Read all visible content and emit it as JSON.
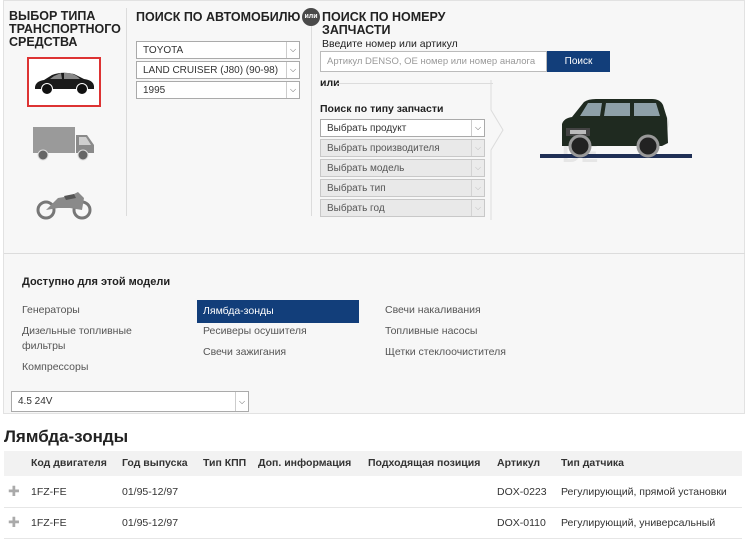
{
  "vehicle_type": {
    "title_lines": [
      "ВЫБОР ТИПА",
      "ТРАНСПОРТНОГО",
      "СРЕДСТВА"
    ],
    "types": [
      {
        "name": "car",
        "selected": true
      },
      {
        "name": "truck",
        "selected": false
      },
      {
        "name": "motorcycle",
        "selected": false
      }
    ]
  },
  "by_auto": {
    "title": "ПОИСК ПО АВТОМОБИЛЮ",
    "make": "TOYOTA",
    "model": "LAND CRUISER (J80) (90-98)",
    "year": "1995"
  },
  "or_badge": "или",
  "by_number": {
    "title_lines": [
      "ПОИСК ПО НОМЕРУ",
      "ЗАПЧАСТИ"
    ],
    "prompt": "Введите номер или артикул",
    "placeholder": "Артикул DENSO, OE номер или номер аналога",
    "button": "Поиск",
    "or_label": "или"
  },
  "by_part_type": {
    "title": "Поиск по типу запчасти",
    "selects": [
      "Выбрать продукт",
      "Выбрать производителя",
      "Выбрать модель",
      "Выбрать тип",
      "Выбрать год"
    ]
  },
  "available": {
    "title": "Доступно для этой модели",
    "col1": [
      "Генераторы",
      "Дизельные топливные",
      "фильтры",
      "Компрессоры"
    ],
    "col2": [
      "Лямбда-зонды",
      "Ресиверы осушителя",
      "Свечи зажигания"
    ],
    "col3": [
      "Свечи накаливания",
      "Топливные насосы",
      "Щетки стеклоочистителя"
    ],
    "active": "Лямбда-зонды"
  },
  "engine_select": "4.5 24V",
  "section_title": "Лямбда-зонды",
  "table": {
    "columns": [
      "Код двигателя",
      "Год выпуска",
      "Тип КПП",
      "Доп. информация",
      "Подходящая позиция",
      "Артикул",
      "Тип датчика"
    ],
    "rows": [
      {
        "engine": "1FZ-FE",
        "years": "01/95-12/97",
        "gearbox": "",
        "info": "",
        "position": "",
        "article": "DOX-0223",
        "sensor_type": "Регулирующий, прямой установки"
      },
      {
        "engine": "1FZ-FE",
        "years": "01/95-12/97",
        "gearbox": "",
        "info": "",
        "position": "",
        "article": "DOX-0110",
        "sensor_type": "Регулирующий, универсальный"
      }
    ]
  },
  "colors": {
    "brand_blue": "#123e7a",
    "selected_border": "#dd3333"
  }
}
